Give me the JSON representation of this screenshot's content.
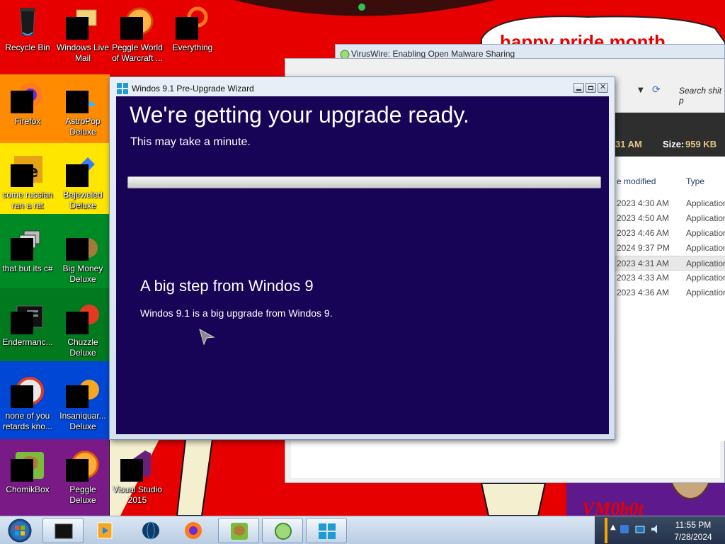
{
  "wallpaper": {
    "banner_text": "happy pride month",
    "signature_text": "VM0b0t"
  },
  "desktop_icons": [
    {
      "label": "Recycle Bin",
      "icon": "recycle-bin-icon"
    },
    {
      "label": "Windows Live Mail",
      "icon": "mail-icon"
    },
    {
      "label": "Peggle World of Warcraft ...",
      "icon": "peggle-icon"
    },
    {
      "label": "Everything",
      "icon": "search-magnifier-icon"
    },
    {
      "label": "Firefox",
      "icon": "firefox-icon"
    },
    {
      "label": "AstroPop Deluxe",
      "icon": "astropop-icon"
    },
    {
      "label": "some russian ran a rat",
      "icon": "app-icon"
    },
    {
      "label": "Bejeweled Deluxe",
      "icon": "bejeweled-icon"
    },
    {
      "label": "that but its c#",
      "icon": "windows-stack-icon"
    },
    {
      "label": "Big Money Deluxe",
      "icon": "money-bag-icon"
    },
    {
      "label": "Endermanc...",
      "icon": "console-icon"
    },
    {
      "label": "Chuzzle Deluxe",
      "icon": "chuzzle-icon"
    },
    {
      "label": "none of you retards kno...",
      "icon": "app-icon"
    },
    {
      "label": "Insaniquar... Deluxe",
      "icon": "insaniquarium-icon"
    },
    {
      "label": "ChomikBox",
      "icon": "chomikbox-icon"
    },
    {
      "label": "Peggle Deluxe",
      "icon": "peggle-icon"
    },
    {
      "label": "Visual Studio 2015",
      "icon": "visual-studio-icon"
    }
  ],
  "background_window": {
    "title": "VirusWire: Enabling Open Malware Sharing"
  },
  "explorer": {
    "search_placeholder": "Search shit p",
    "date_partial": "31 AM",
    "size_label": "Size:",
    "size_value": "959 KB",
    "columns": [
      "e modified",
      "Type"
    ],
    "rows": [
      {
        "date": "2023 4:30 AM",
        "type": "Application"
      },
      {
        "date": "2023 4:50 AM",
        "type": "Application"
      },
      {
        "date": "2023 4:46 AM",
        "type": "Application"
      },
      {
        "date": "2024 9:37 PM",
        "type": "Application"
      },
      {
        "date": "2023 4:31 AM",
        "type": "Application"
      },
      {
        "date": "2023 4:33 AM",
        "type": "Application"
      },
      {
        "date": "2023 4:36 AM",
        "type": "Application"
      }
    ]
  },
  "wizard": {
    "title": "Windos 9.1 Pre-Upgrade Wizard",
    "heading": "We're getting your upgrade ready.",
    "subheading": "This may take a minute.",
    "progress": 0,
    "info_title": "A big step from Windos 9",
    "info_text": "Windos 9.1 is a big upgrade from Windos 9."
  },
  "taskbar": {
    "items": [
      "cmd-window-icon",
      "media-player-icon",
      "globe-icon",
      "firefox-icon",
      "chomikbox-icon",
      "viruswire-icon",
      "windows-upgrade-icon"
    ],
    "clock_time": "11:55 PM",
    "clock_date": "7/28/2024"
  },
  "colors": {
    "wizard_body": "#170456",
    "wallpaper_red": "#e60000"
  }
}
